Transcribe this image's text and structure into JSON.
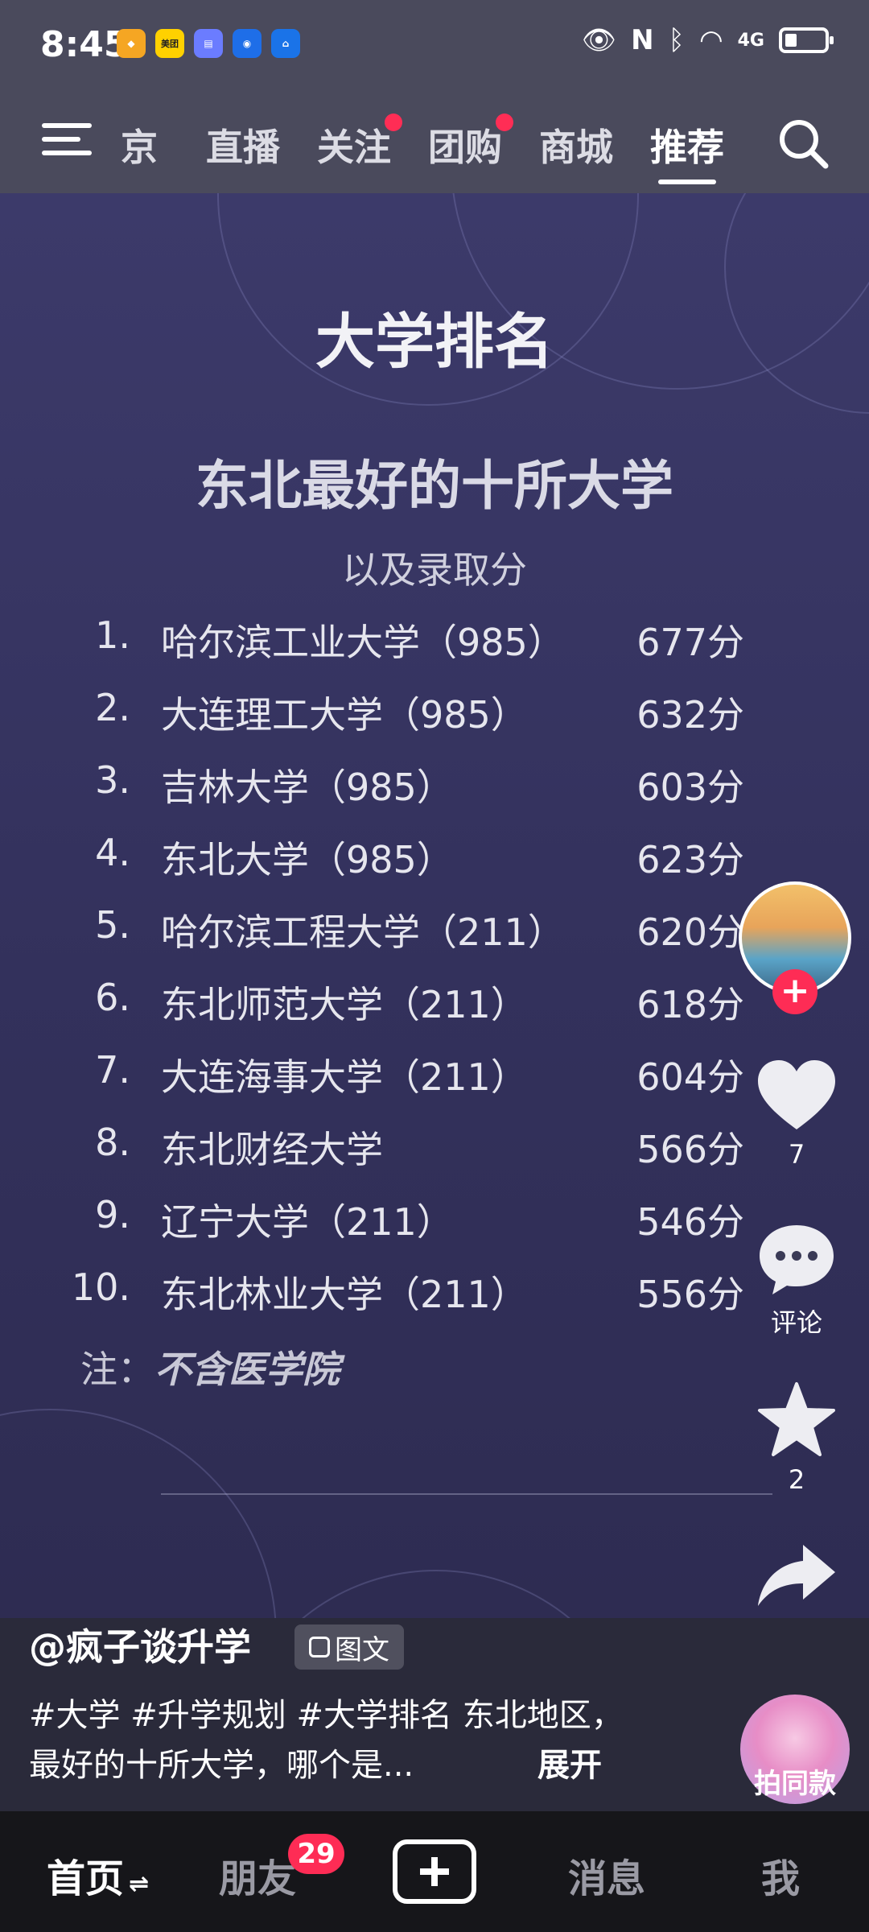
{
  "status_bar": {
    "time": "8:45",
    "app_badges": [
      "美团"
    ],
    "network": "4G"
  },
  "top_nav": {
    "tabs": [
      {
        "label": "京",
        "dot": false,
        "active": false
      },
      {
        "label": "直播",
        "dot": false,
        "active": false
      },
      {
        "label": "关注",
        "dot": true,
        "active": false
      },
      {
        "label": "团购",
        "dot": true,
        "active": false
      },
      {
        "label": "商城",
        "dot": false,
        "active": false
      },
      {
        "label": "推荐",
        "dot": false,
        "active": true
      }
    ]
  },
  "post": {
    "title": "大学排名",
    "subtitle": "东北最好的十所大学",
    "subnote": "以及录取分",
    "rankings": [
      {
        "num": "1.",
        "name": "哈尔滨工业大学（985）",
        "score": "677分"
      },
      {
        "num": "2.",
        "name": "大连理工大学（985）",
        "score": "632分"
      },
      {
        "num": "3.",
        "name": "吉林大学（985）",
        "score": "603分"
      },
      {
        "num": "4.",
        "name": "东北大学（985）",
        "score": "623分"
      },
      {
        "num": "5.",
        "name": "哈尔滨工程大学（211）",
        "score": "620分"
      },
      {
        "num": "6.",
        "name": "东北师范大学（211）",
        "score": "618分"
      },
      {
        "num": "7.",
        "name": "大连海事大学（211）",
        "score": "604分"
      },
      {
        "num": "8.",
        "name": "东北财经大学",
        "score": "566分"
      },
      {
        "num": "9.",
        "name": "辽宁大学（211）",
        "score": "546分"
      },
      {
        "num": "10.",
        "name": "东北林业大学（211）",
        "score": "556分"
      }
    ],
    "note_label": "注：",
    "note_text": "不含医学院"
  },
  "right_rail": {
    "like_count": "7",
    "comment_label": "评论",
    "favorite_count": "2",
    "share_label": "分享",
    "same_style_label": "拍同款"
  },
  "caption": {
    "author": "@疯子谈升学",
    "type_badge": "图文",
    "description": "#大学 #升学规划 #大学排名 东北地区，最好的十所大学，哪个是...",
    "expand_label": "展开"
  },
  "bottom_nav": {
    "home": "首页",
    "home_suffix": "⇌",
    "friends": "朋友",
    "friends_badge": "29",
    "messages": "消息",
    "me": "我"
  },
  "colors": {
    "accent_red": "#fe2c55",
    "content_bg": "#3c3a6a"
  }
}
